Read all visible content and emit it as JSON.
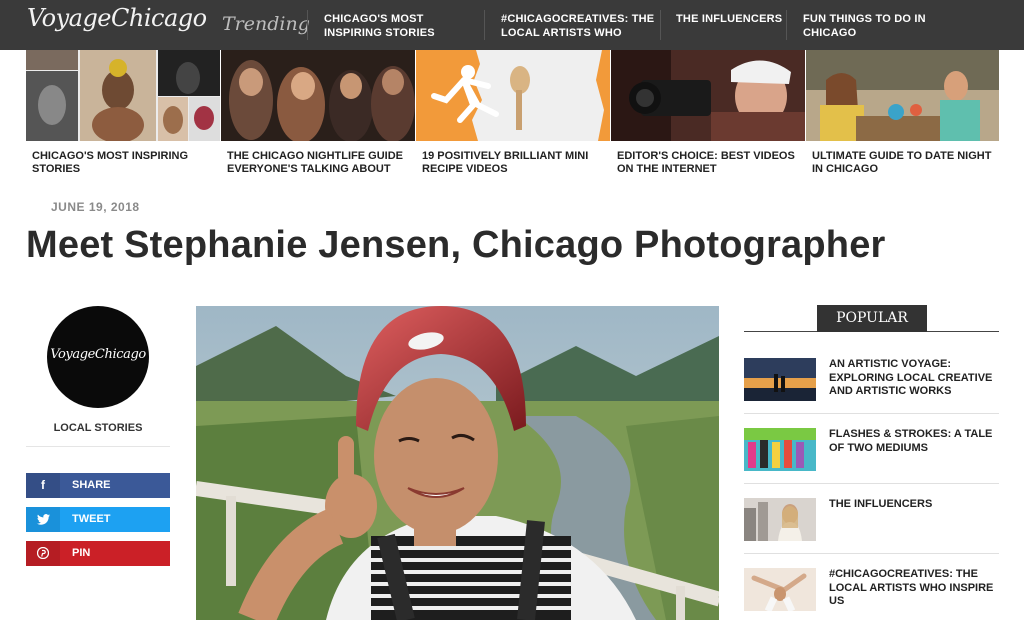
{
  "site": {
    "logo": "VoyageChicago",
    "trending_label": "Trending"
  },
  "nav": {
    "links": [
      "CHICAGO'S MOST INSPIRING STORIES",
      "#CHICAGOCREATIVES: THE LOCAL ARTISTS WHO",
      "THE INFLUENCERS",
      "FUN THINGS TO DO IN CHICAGO"
    ]
  },
  "trending": [
    {
      "caption": "CHICAGO'S MOST INSPIRING STORIES",
      "image": "portrait-collage"
    },
    {
      "caption": "THE CHICAGO NIGHTLIFE GUIDE EVERYONE'S TALKING ABOUT",
      "image": "nightlife-crowd"
    },
    {
      "caption": "19 POSITIVELY BRILLIANT MINI RECIPE VIDEOS",
      "image": "orange-runner"
    },
    {
      "caption": "EDITOR'S CHOICE: BEST VIDEOS ON THE INTERNET",
      "image": "videographer"
    },
    {
      "caption": "ULTIMATE GUIDE TO DATE NIGHT IN CHICAGO",
      "image": "dinner-date"
    }
  ],
  "article": {
    "date": "JUNE 19, 2018",
    "title": "Meet Stephanie Jensen, Chicago Photographer",
    "hero_image": "selfie-helmet-river-valley"
  },
  "sidebar": {
    "avatar_text": "VoyageChicago",
    "section_label": "LOCAL STORIES",
    "share_buttons": [
      {
        "label": "SHARE",
        "icon": "facebook-icon",
        "color": "#3b5998",
        "icon_bg": "#344e86",
        "glyph": "f"
      },
      {
        "label": "TWEET",
        "icon": "twitter-icon",
        "color": "#1da1f2",
        "icon_bg": "#1a91da",
        "glyph": "🐦"
      },
      {
        "label": "PIN",
        "icon": "pinterest-icon",
        "color": "#cb2027",
        "icon_bg": "#b51d23",
        "glyph": "℗"
      }
    ]
  },
  "popular": {
    "heading": "POPULAR",
    "items": [
      {
        "title": "AN ARTISTIC VOYAGE: EXPLORING LOCAL CREATIVE AND ARTISTIC WORKS",
        "image": "sunset-couple"
      },
      {
        "title": "FLASHES & STROKES: A TALE OF TWO MEDIUMS",
        "image": "colorful-group"
      },
      {
        "title": "THE INFLUENCERS",
        "image": "city-portrait"
      },
      {
        "title": "#CHICAGOCREATIVES: THE LOCAL ARTISTS WHO INSPIRE US",
        "image": "dancer"
      }
    ]
  }
}
